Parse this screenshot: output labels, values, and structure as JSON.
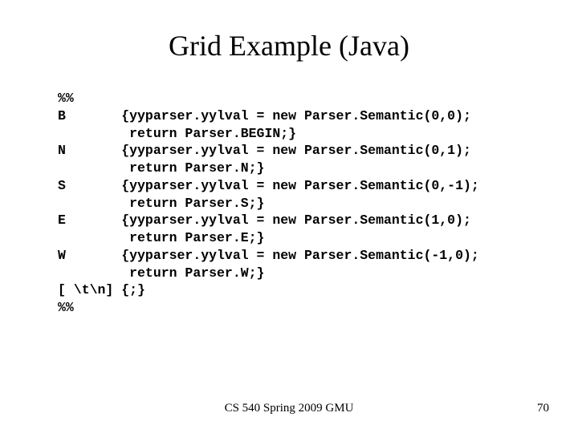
{
  "title": "Grid Example (Java)",
  "code": "%%\nB       {yyparser.yylval = new Parser.Semantic(0,0);\n         return Parser.BEGIN;}\nN       {yyparser.yylval = new Parser.Semantic(0,1);\n         return Parser.N;}\nS       {yyparser.yylval = new Parser.Semantic(0,-1);\n         return Parser.S;}\nE       {yyparser.yylval = new Parser.Semantic(1,0);\n         return Parser.E;}\nW       {yyparser.yylval = new Parser.Semantic(-1,0);\n         return Parser.W;}\n[ \\t\\n] {;}\n%%",
  "footer": {
    "center": "CS 540 Spring 2009 GMU",
    "page": "70"
  }
}
